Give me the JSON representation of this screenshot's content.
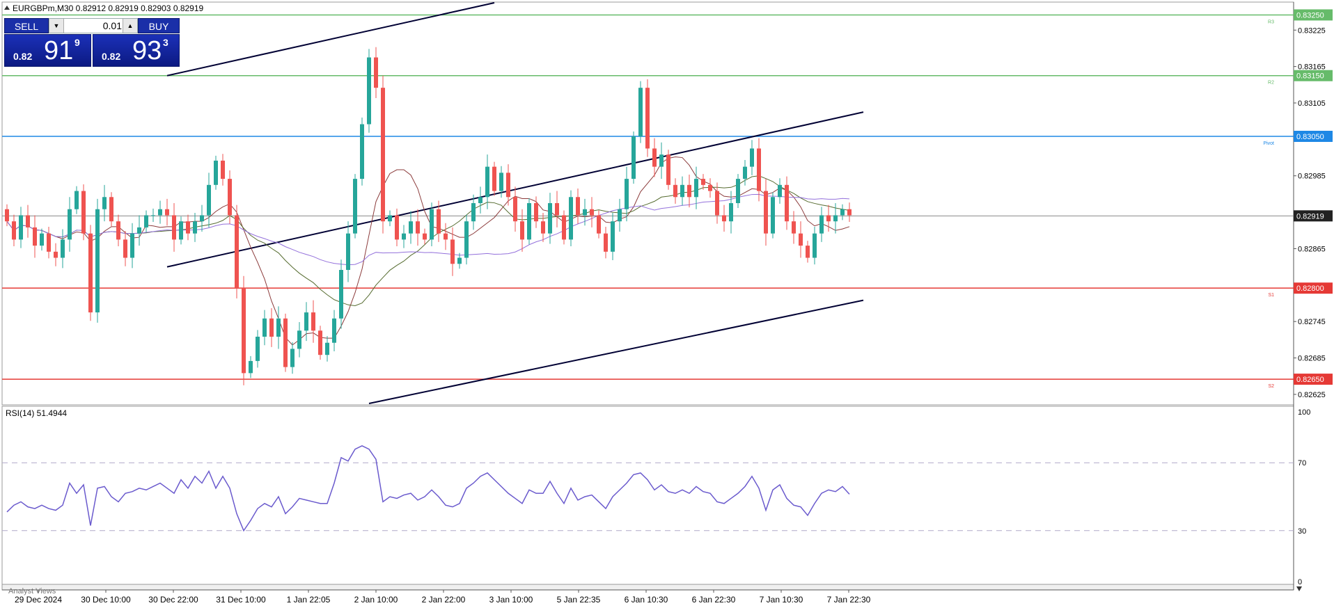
{
  "header": {
    "symbol_line": "EURGBPm,M30  0.82912 0.82919 0.82903 0.82919",
    "rsi_label": "RSI(14) 51.4944",
    "analyst_views_label": "Analyst Views"
  },
  "trade_panel": {
    "sell_label": "SELL",
    "buy_label": "BUY",
    "lot_value": "0.01",
    "sell_price": {
      "prefix": "0.82",
      "big": "91",
      "sup": "9"
    },
    "buy_price": {
      "prefix": "0.82",
      "big": "93",
      "sup": "3"
    }
  },
  "colors": {
    "bull": "#26a69a",
    "bear": "#ef5350",
    "resistance": "#66bb6a",
    "support": "#e53935",
    "pivot": "#1e88e5",
    "rsi": "#6a5acd",
    "trendline": "#000033"
  },
  "chart_data": [
    {
      "type": "candlestick",
      "symbol": "EURGBPm",
      "timeframe": "M30",
      "ohlc_header": {
        "open": 0.82912,
        "high": 0.82919,
        "low": 0.82903,
        "close": 0.82919
      },
      "current_price": 0.82919,
      "current_price_label": "0.82919",
      "ylim": [
        0.8261,
        0.8327
      ],
      "y_ticks": [
        "0.83225",
        "0.83165",
        "0.83105",
        "0.82985",
        "0.82865",
        "0.82745",
        "0.82685",
        "0.82625"
      ],
      "x_ticks": [
        "29 Dec 2024",
        "30 Dec 10:00",
        "30 Dec 22:00",
        "31 Dec 10:00",
        "1 Jan 22:05",
        "2 Jan 10:00",
        "2 Jan 22:00",
        "3 Jan 10:00",
        "5 Jan 22:35",
        "6 Jan 10:30",
        "6 Jan 22:30",
        "7 Jan 10:30",
        "7 Jan 22:30"
      ],
      "levels": [
        {
          "name": "R3",
          "value": 0.8325,
          "label": "0.83250",
          "kind": "resistance"
        },
        {
          "name": "R2",
          "value": 0.8315,
          "label": "0.83150",
          "kind": "resistance"
        },
        {
          "name": "Pivot",
          "value": 0.8305,
          "label": "0.83050",
          "kind": "pivot"
        },
        {
          "name": "S1",
          "value": 0.828,
          "label": "0.82800",
          "kind": "support"
        },
        {
          "name": "S2",
          "value": 0.8265,
          "label": "0.82650",
          "kind": "support"
        }
      ],
      "trendlines": [
        {
          "from": [
            23,
            0.8315
          ],
          "to": [
            70,
            0.8327
          ]
        },
        {
          "from": [
            23,
            0.82835
          ],
          "to": [
            123,
            0.8309
          ]
        },
        {
          "from": [
            52,
            0.8261
          ],
          "to": [
            123,
            0.8278
          ]
        }
      ],
      "closes": [
        0.8291,
        0.8288,
        0.8292,
        0.829,
        0.8287,
        0.8289,
        0.8286,
        0.8285,
        0.8288,
        0.8293,
        0.8296,
        0.8289,
        0.8276,
        0.8293,
        0.8295,
        0.8291,
        0.8288,
        0.8285,
        0.8289,
        0.829,
        0.8292,
        0.8292,
        0.8293,
        0.8292,
        0.8288,
        0.8291,
        0.8289,
        0.8291,
        0.8292,
        0.8297,
        0.8301,
        0.8298,
        0.8292,
        0.828,
        0.8266,
        0.8268,
        0.8272,
        0.8275,
        0.8272,
        0.8275,
        0.8267,
        0.827,
        0.8273,
        0.8276,
        0.8273,
        0.8269,
        0.8271,
        0.8275,
        0.8283,
        0.8289,
        0.8298,
        0.8307,
        0.8318,
        0.8313,
        0.8291,
        0.8292,
        0.8288,
        0.8289,
        0.8291,
        0.8289,
        0.8288,
        0.8293,
        0.8289,
        0.8288,
        0.8284,
        0.8285,
        0.8291,
        0.8294,
        0.8295,
        0.83,
        0.8296,
        0.8299,
        0.8295,
        0.8291,
        0.8288,
        0.8294,
        0.8291,
        0.8289,
        0.8294,
        0.8292,
        0.8288,
        0.8295,
        0.8292,
        0.8293,
        0.8292,
        0.8289,
        0.8286,
        0.8291,
        0.8293,
        0.8298,
        0.8305,
        0.8313,
        0.8303,
        0.83,
        0.8302,
        0.8297,
        0.8295,
        0.8297,
        0.8295,
        0.8298,
        0.8297,
        0.8296,
        0.8292,
        0.8291,
        0.8294,
        0.8298,
        0.83,
        0.8303,
        0.8296,
        0.8289,
        0.8295,
        0.8297,
        0.8291,
        0.8289,
        0.8287,
        0.8285,
        0.8289,
        0.8292,
        0.8291,
        0.8292,
        0.8293,
        0.8292
      ],
      "rsi": {
        "period": 14,
        "value": 51.4944,
        "ylim": [
          0,
          100
        ],
        "y_ticks": [
          "100",
          "70",
          "30",
          "0"
        ],
        "levels": [
          70,
          30
        ],
        "values": [
          41,
          45,
          47,
          44,
          43,
          45,
          43,
          42,
          45,
          58,
          52,
          57,
          33,
          55,
          56,
          50,
          47,
          52,
          53,
          55,
          54,
          56,
          58,
          55,
          52,
          60,
          55,
          62,
          58,
          65,
          55,
          62,
          55,
          40,
          30,
          36,
          43,
          46,
          44,
          50,
          40,
          44,
          49,
          48,
          47,
          46,
          46,
          58,
          73,
          71,
          78,
          80,
          78,
          72,
          47,
          50,
          49,
          51,
          52,
          48,
          50,
          54,
          50,
          45,
          44,
          46,
          55,
          58,
          62,
          64,
          60,
          56,
          52,
          49,
          46,
          54,
          52,
          52,
          59,
          52,
          46,
          55,
          48,
          50,
          51,
          47,
          43,
          50,
          54,
          58,
          63,
          64,
          60,
          54,
          57,
          53,
          52,
          54,
          52,
          56,
          53,
          52,
          47,
          46,
          49,
          52,
          56,
          62,
          55,
          42,
          54,
          57,
          49,
          45,
          44,
          39,
          46,
          52,
          54,
          53,
          56,
          51.49
        ]
      }
    }
  ]
}
